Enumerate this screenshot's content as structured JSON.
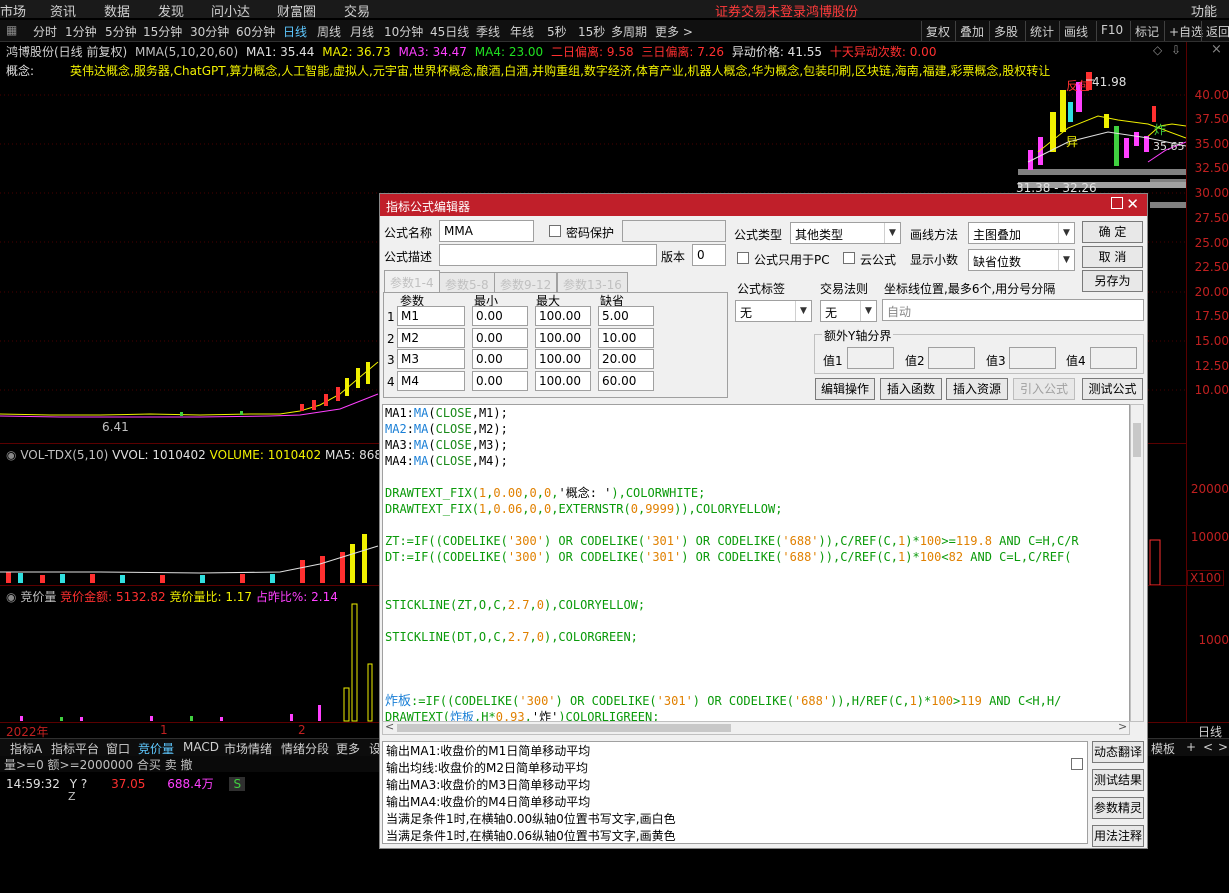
{
  "menubar": {
    "items": [
      "市场",
      "资讯",
      "数据",
      "发现",
      "问小达",
      "财富圈",
      "交易"
    ],
    "status": "证券交易未登录",
    "stock": "鸿博股份",
    "func": "功能"
  },
  "periods": [
    "分时",
    "1分钟",
    "5分钟",
    "15分钟",
    "30分钟",
    "60分钟",
    "日线",
    "周线",
    "月线",
    "10分钟",
    "45日线",
    "季线",
    "年线",
    "5秒",
    "15秒",
    "多周期",
    "更多 >"
  ],
  "active_period": "日线",
  "right_buttons": [
    "复权",
    "叠加",
    "多股",
    "统计",
    "画线",
    "F10",
    "标记",
    "+自选",
    "返回"
  ],
  "info": {
    "title": "鸿博股份(日线 前复权)",
    "ma_label": "MMA(5,10,20,60)",
    "ma1": "MA1: 35.44",
    "ma2": "MA2: 36.73",
    "ma3": "MA3: 34.47",
    "ma4": "MA4: 23.00",
    "d2": "二日偏离: 9.58",
    "d3": "三日偏离: 7.26",
    "abn": "异动价格: 41.55",
    "ten": "十天异动次数: 0.00"
  },
  "concept": {
    "label": "概念:",
    "text": "英伟达概念,服务器,ChatGPT,算力概念,人工智能,虚拟人,元宇宙,世界杯概念,酿酒,白酒,并购重组,数字经济,体育产业,机器人概念,华为概念,包装印刷,区块链,海南,福建,彩票概念,股权转让"
  },
  "price_axis": [
    "40.00",
    "37.50",
    "35.00",
    "32.50",
    "30.00",
    "27.50",
    "25.00",
    "22.50",
    "20.00",
    "17.50",
    "15.00",
    "12.50",
    "10.00"
  ],
  "chart_marks": {
    "high": "41.98",
    "low": "6.41",
    "last": "35.65",
    "range": "31.38 - 32.26",
    "fanbao": "反包",
    "yi": "异",
    "zha": "炸"
  },
  "vol": {
    "label": "VOL-TDX(5,10)",
    "vvol": "VVOL: 1010402",
    "volume": "VOLUME: 1010402",
    "ma5": "MA5: 868629",
    "axis1": "20000",
    "axis2": "10000",
    "unit": "X100"
  },
  "auction": {
    "label": "竞价量",
    "amount": "竞价金额: 5132.82",
    "ratio": "竞价量比: 1.17",
    "pct": "占昨比%: 2.14",
    "axis": "1000"
  },
  "timeline": {
    "year": "2022年",
    "m1": "1",
    "m2": "2",
    "right": "日线"
  },
  "bottom_tabs": [
    "指标A",
    "指标平台",
    "窗口",
    "竞价量",
    "MACD",
    "市场情绪",
    "情绪分段",
    "更多",
    "设"
  ],
  "bottom_right": [
    "模板",
    "+",
    "<",
    ">"
  ],
  "ticker": {
    "cond": "量>=0 额>=2000000 合买 卖 撤",
    "time": "14:59:32",
    "q": "Y ?",
    "price": "37.05",
    "amount": "688.4万",
    "side": "S",
    "z": "Z"
  },
  "dialog": {
    "title": "指标公式编辑器",
    "name_label": "公式名称",
    "name_value": "MMA",
    "pwd_label": "密码保护",
    "type_label": "公式类型",
    "type_value": "其他类型",
    "draw_label": "画线方法",
    "draw_value": "主图叠加",
    "ok": "确  定",
    "cancel": "取  消",
    "saveas": "另存为",
    "desc_label": "公式描述",
    "version_label": "版本",
    "version_value": "0",
    "pc_only": "公式只用于PC",
    "cloud": "云公式",
    "decimals_label": "显示小数",
    "decimals_value": "缺省位数",
    "tabs": [
      "参数1-4",
      "参数5-8",
      "参数9-12",
      "参数13-16"
    ],
    "param_headers": [
      "参数",
      "最小",
      "最大",
      "缺省"
    ],
    "params": [
      {
        "idx": "1",
        "name": "M1",
        "min": "0.00",
        "max": "100.00",
        "def": "5.00"
      },
      {
        "idx": "2",
        "name": "M2",
        "min": "0.00",
        "max": "100.00",
        "def": "10.00"
      },
      {
        "idx": "3",
        "name": "M3",
        "min": "0.00",
        "max": "100.00",
        "def": "20.00"
      },
      {
        "idx": "4",
        "name": "M4",
        "min": "0.00",
        "max": "100.00",
        "def": "60.00"
      }
    ],
    "tag_label": "公式标签",
    "tag_value": "无",
    "rule_label": "交易法则",
    "rule_value": "无",
    "coord_label": "坐标线位置,最多6个,用分号分隔",
    "coord_value": "自动",
    "extra_y": "额外Y轴分界",
    "v1": "值1",
    "v2": "值2",
    "v3": "值3",
    "v4": "值4",
    "edit": "编辑操作",
    "ins_func": "插入函数",
    "ins_res": "插入资源",
    "import": "引入公式",
    "test": "测试公式",
    "side_buttons": [
      "动态翻译",
      "测试结果",
      "参数精灵",
      "用法注释"
    ],
    "desc_lines": [
      "输出MA1:收盘价的M1日简单移动平均",
      "输出均线:收盘价的M2日简单移动平均",
      "输出MA3:收盘价的M3日简单移动平均",
      "输出MA4:收盘价的M4日简单移动平均",
      "当满足条件1时,在横轴0.00纵轴0位置书写文字,画白色",
      "当满足条件1时,在横轴0.06纵轴0位置书写文字,画黄色"
    ]
  }
}
